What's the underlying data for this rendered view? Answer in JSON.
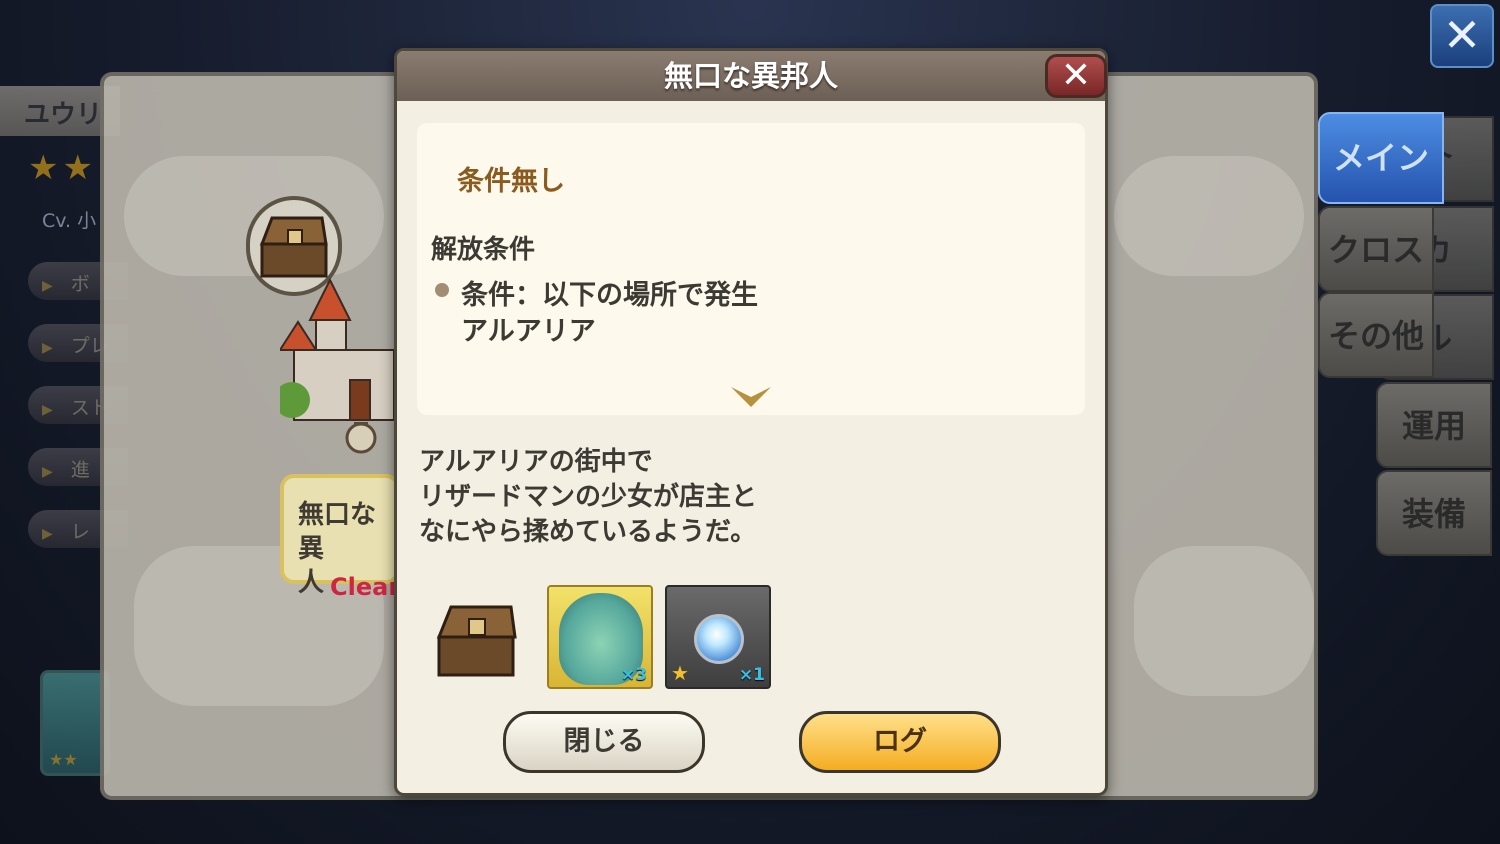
{
  "left_panel": {
    "name": "ユウリ",
    "stars": "★★",
    "cv": "Cv. 小",
    "buttons": [
      "ボ",
      "プレ",
      "スト",
      "進",
      "レ"
    ],
    "thumb_stars": "★★"
  },
  "map": {
    "quest_title": "無口な異\n人",
    "clear_label": "Clear"
  },
  "right_tabs": {
    "close_icon": "✕",
    "tabs": [
      {
        "label": "メイン",
        "state": "active"
      },
      {
        "label": "クロス",
        "state": "normal"
      },
      {
        "label": "その他",
        "state": "normal"
      }
    ],
    "behind_tabs": [
      "介",
      "カ",
      "ル",
      "運用",
      "装備"
    ]
  },
  "modal": {
    "title": "無口な異邦人",
    "close_icon": "✕",
    "condition_title": "条件無し",
    "release_label": "解放条件",
    "condition_text": "条件：以下の場所で発生",
    "condition_place": "アルアリア",
    "description_lines": [
      "アルアリアの街中で",
      "リザードマンの少女が店主と",
      "なにやら揉めているようだ。"
    ],
    "rewards": [
      {
        "type": "chest-icon"
      },
      {
        "type": "character-portrait",
        "qty": "×3"
      },
      {
        "type": "water-orb",
        "qty": "×1"
      }
    ],
    "buttons": {
      "close": "閉じる",
      "log": "ログ"
    }
  },
  "colors": {
    "accent_blue": "#2553ad",
    "log_button": "#f4ad22",
    "clear_red": "#cf2640"
  }
}
